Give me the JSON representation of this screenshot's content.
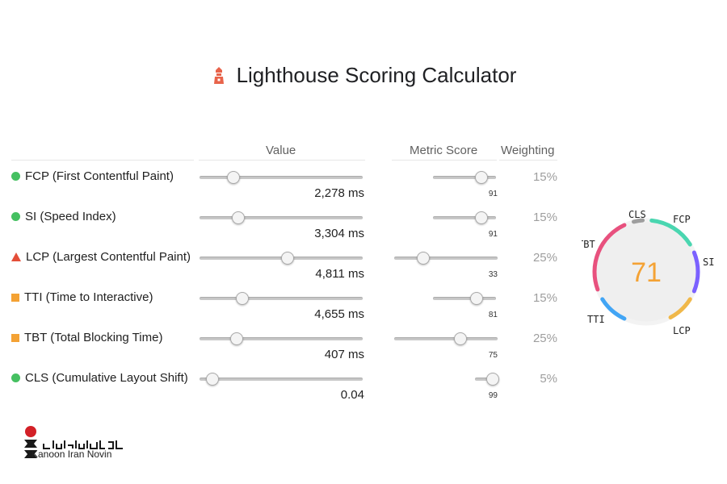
{
  "page": {
    "title": "Lighthouse Scoring Calculator",
    "columns": {
      "value": "Value",
      "metric_score": "Metric Score",
      "weighting": "Weighting"
    }
  },
  "metrics": [
    {
      "name": "FCP (First Contentful Paint)",
      "shape": "circle",
      "value_label": "2,278 ms",
      "value_fraction": 0.21,
      "score": "91",
      "score_fraction": 0.91,
      "weighting": "15%"
    },
    {
      "name": "SI (Speed Index)",
      "shape": "circle",
      "value_label": "3,304 ms",
      "value_fraction": 0.24,
      "score": "91",
      "score_fraction": 0.91,
      "weighting": "15%"
    },
    {
      "name": "LCP (Largest Contentful Paint)",
      "shape": "triangle",
      "value_label": "4,811 ms",
      "value_fraction": 0.54,
      "score": "33",
      "score_fraction": 0.33,
      "weighting": "25%"
    },
    {
      "name": "TTI (Time to Interactive)",
      "shape": "square",
      "value_label": "4,655 ms",
      "value_fraction": 0.26,
      "score": "81",
      "score_fraction": 0.81,
      "weighting": "15%"
    },
    {
      "name": "TBT (Total Blocking Time)",
      "shape": "square",
      "value_label": "407 ms",
      "value_fraction": 0.23,
      "score": "75",
      "score_fraction": 0.75,
      "weighting": "25%"
    },
    {
      "name": "CLS (Cumulative Layout Shift)",
      "shape": "circle",
      "value_label": "0.04",
      "value_fraction": 0.08,
      "score": "99",
      "score_fraction": 0.99,
      "weighting": "5%"
    }
  ],
  "gauge": {
    "overall_score": "71",
    "score_color": "#f4a234",
    "labels": {
      "cls": "CLS",
      "fcp": "FCP",
      "si": "SI",
      "lcp": "LCP",
      "tti": "TTI",
      "tbt": "TBT"
    },
    "colors": {
      "cls": "#9e9e9e",
      "fcp": "#4ad6b0",
      "si": "#7b61ff",
      "lcp": "#f0b84a",
      "tti": "#42a5f5",
      "tbt": "#e8517e"
    }
  },
  "brand": {
    "name": "Kanoon Iran Novin",
    "persian_name": "کانون ایران نوین"
  }
}
